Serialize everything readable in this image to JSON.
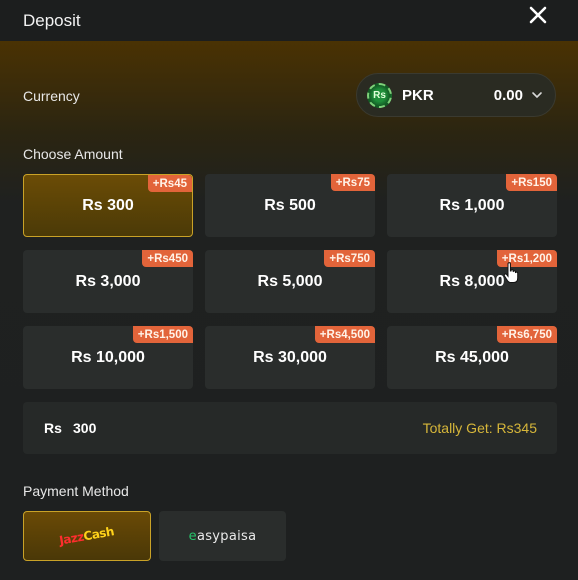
{
  "header": {
    "title": "Deposit"
  },
  "currency": {
    "label": "Currency",
    "code": "PKR",
    "balance": "0.00",
    "icon_text": "Rs"
  },
  "choose_amount": {
    "label": "Choose Amount",
    "options": [
      {
        "amount": "Rs 300",
        "bonus": "+Rs45",
        "selected": true
      },
      {
        "amount": "Rs 500",
        "bonus": "+Rs75"
      },
      {
        "amount": "Rs 1,000",
        "bonus": "+Rs150"
      },
      {
        "amount": "Rs 3,000",
        "bonus": "+Rs450"
      },
      {
        "amount": "Rs 5,000",
        "bonus": "+Rs750"
      },
      {
        "amount": "Rs 8,000",
        "bonus": "+Rs1,200"
      },
      {
        "amount": "Rs 10,000",
        "bonus": "+Rs1,500"
      },
      {
        "amount": "Rs 30,000",
        "bonus": "+Rs4,500"
      },
      {
        "amount": "Rs 45,000",
        "bonus": "+Rs6,750"
      }
    ]
  },
  "summary": {
    "currency_prefix": "Rs",
    "amount": "300",
    "total_text": "Totally Get: Rs345"
  },
  "payment": {
    "label": "Payment Method",
    "methods": [
      {
        "name": "JazzCash",
        "logo_part1": "Jazz",
        "logo_part2": "Cash",
        "selected": true
      },
      {
        "name": "easypaisa",
        "logo_part1": "e",
        "logo_part2": "asypaisa"
      }
    ]
  },
  "colors": {
    "accent_gold": "#c9a227",
    "badge": "#e2643a",
    "total_text": "#d6b63a"
  }
}
